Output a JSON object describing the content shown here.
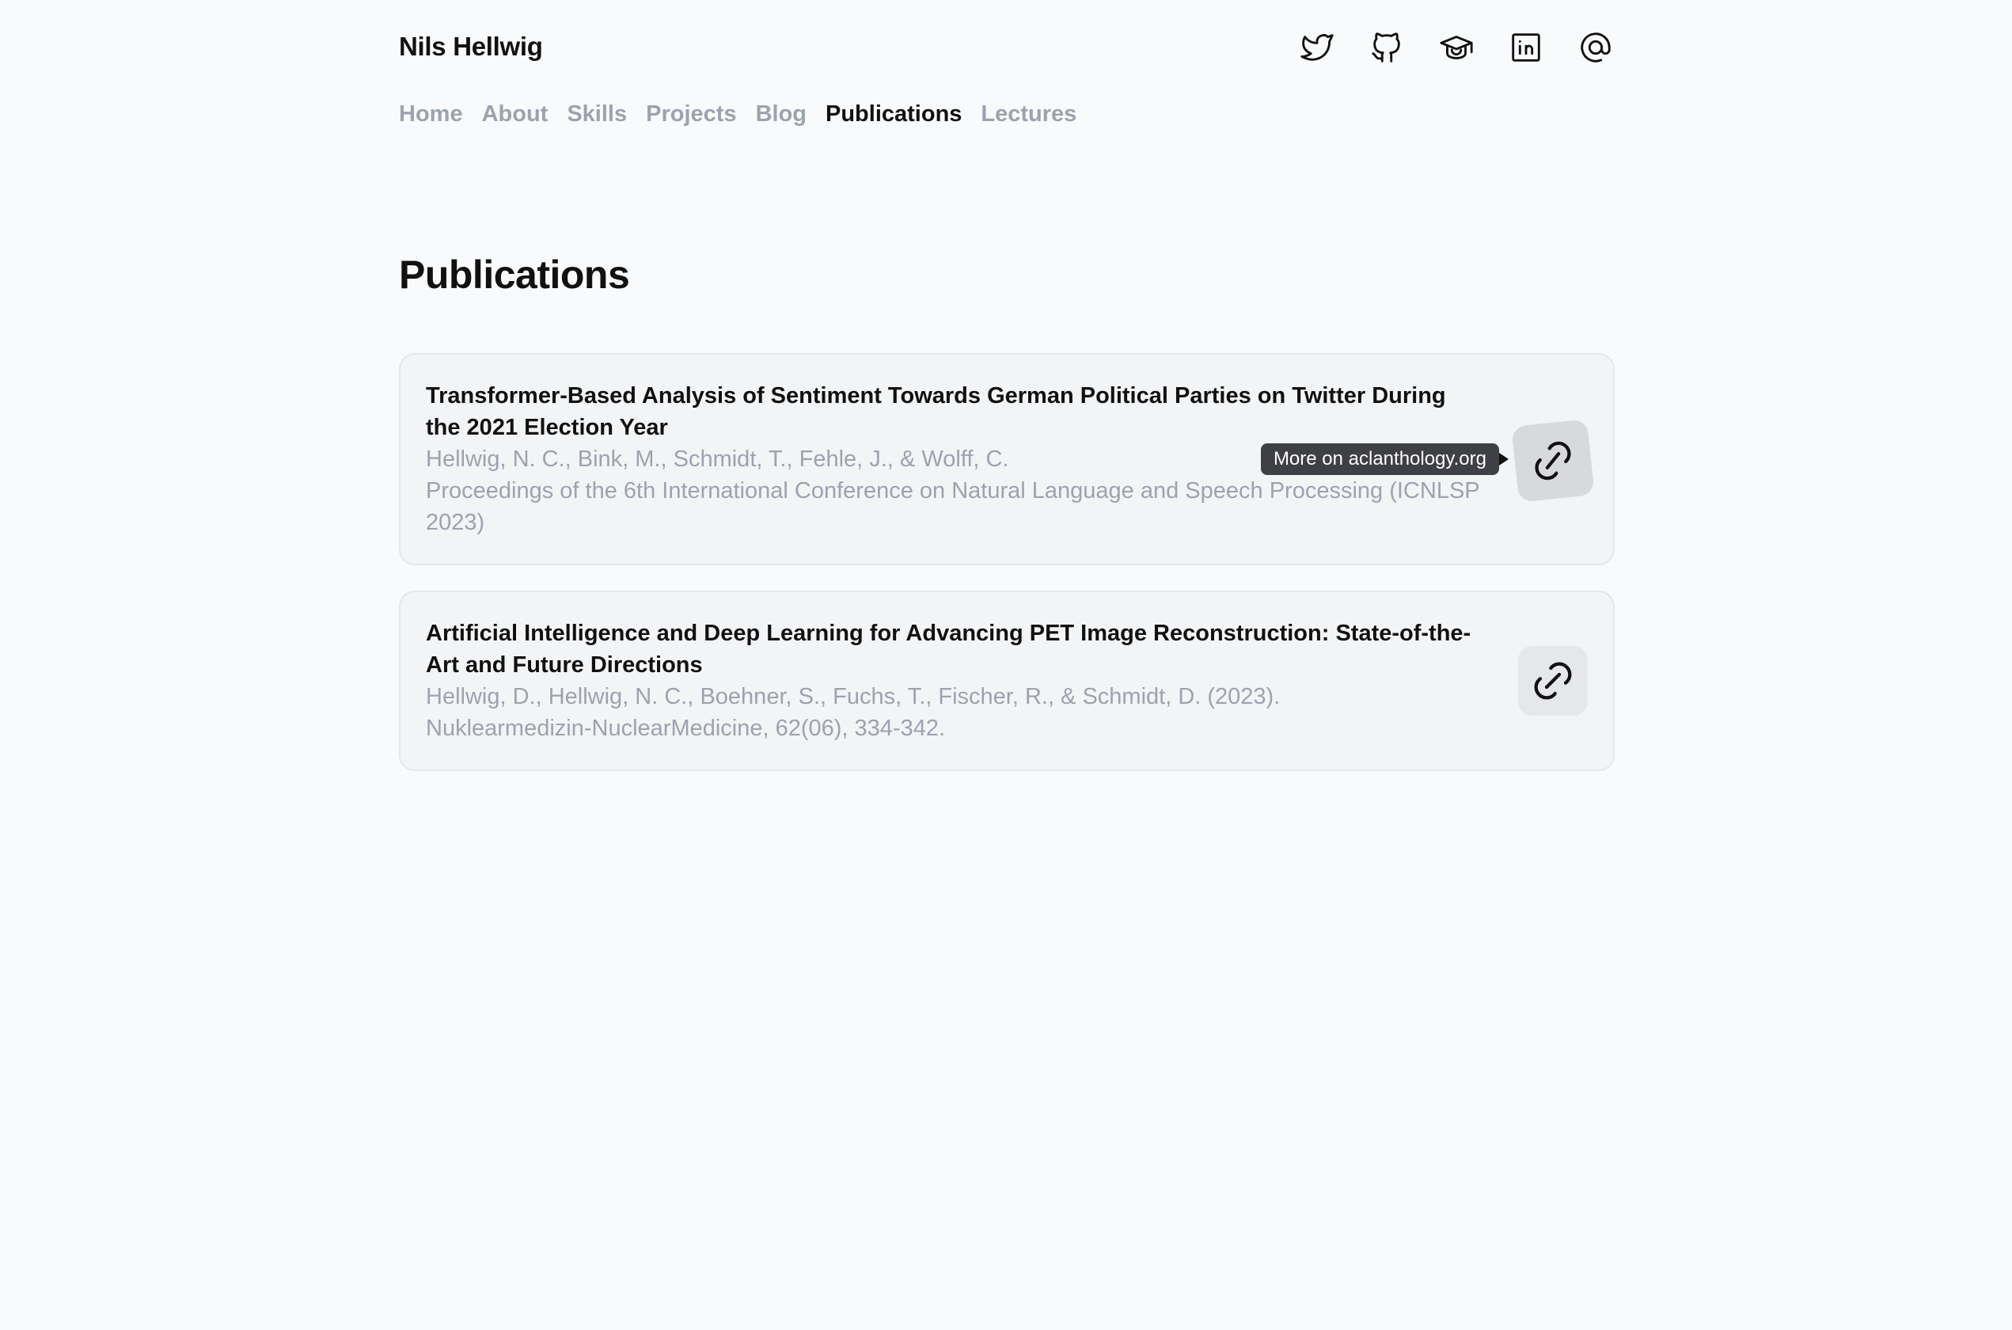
{
  "site": {
    "name": "Nils Hellwig"
  },
  "social": [
    {
      "icon": "twitter-icon"
    },
    {
      "icon": "github-icon"
    },
    {
      "icon": "scholar-icon"
    },
    {
      "icon": "linkedin-icon"
    },
    {
      "icon": "email-icon"
    }
  ],
  "nav": {
    "items": [
      {
        "label": "Home"
      },
      {
        "label": "About"
      },
      {
        "label": "Skills"
      },
      {
        "label": "Projects"
      },
      {
        "label": "Blog"
      },
      {
        "label": "Publications",
        "active": true
      },
      {
        "label": "Lectures"
      }
    ]
  },
  "page": {
    "title": "Publications"
  },
  "publications": [
    {
      "title": "Transformer-Based Analysis of Sentiment Towards German Political Parties on Twitter During the 2021 Election Year",
      "authors": "Hellwig, N. C., Bink, M., Schmidt, T., Fehle, J., & Wolff, C.",
      "venue": "Proceedings of the 6th International Conference on Natural Language and Speech Processing (ICNLSP 2023)",
      "tooltip": "More on aclanthology.org"
    },
    {
      "title": "Artificial Intelligence and Deep Learning for Advancing PET Image Reconstruction: State-of-the-Art and Future Directions",
      "authors": "Hellwig, D., Hellwig, N. C., Boehner, S., Fuchs, T., Fischer, R., & Schmidt, D. (2023).",
      "venue": "Nuklearmedizin-NuclearMedicine, 62(06), 334-342."
    }
  ],
  "colors": {
    "background": "#f9fafb",
    "card": "#f3f4f6",
    "muted_text": "#9ca3af",
    "tooltip_bg": "#3f3f46"
  }
}
